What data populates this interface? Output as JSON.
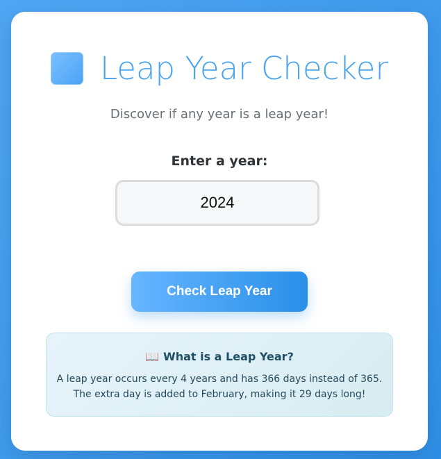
{
  "app": {
    "title": "Leap Year Checker",
    "subtitle": "Discover if any year is a leap year!"
  },
  "form": {
    "label": "Enter a year:",
    "input_value": "2024",
    "button_label": "Check Leap Year"
  },
  "info": {
    "icon": "book-icon",
    "icon_glyph": "📖",
    "title": "What is a Leap Year?",
    "lines": [
      "A leap year occurs every 4 years and has 366 days instead of 365.",
      "The extra day is added to February, making it 29 days long!"
    ]
  },
  "colors": {
    "accent": "#4aa3ee",
    "button_start": "#66b5ff",
    "button_end": "#2a8fe8",
    "background": "#2f8fe6"
  }
}
